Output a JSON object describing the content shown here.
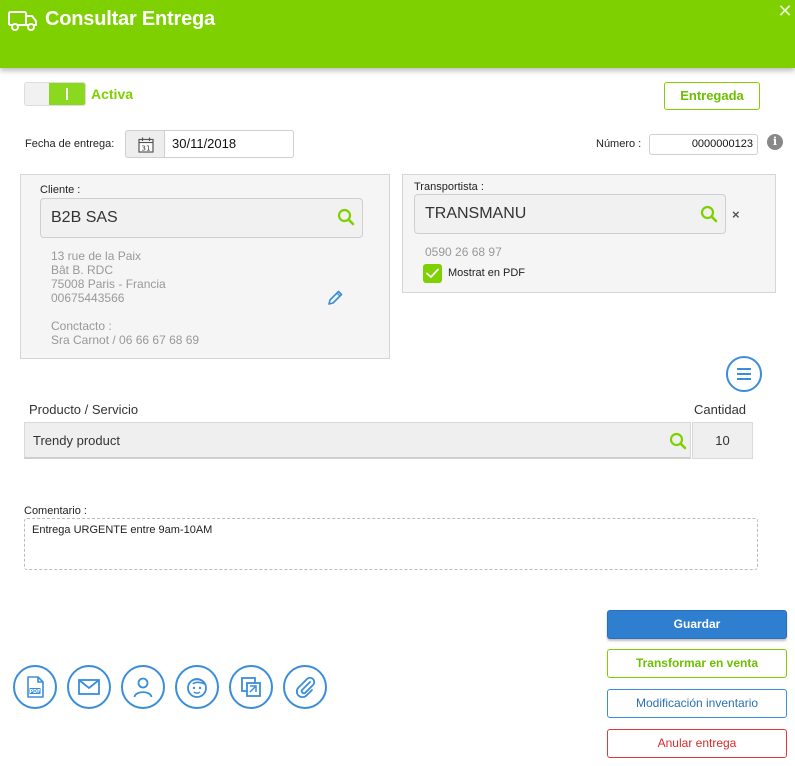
{
  "header": {
    "title": "Consultar Entrega",
    "icon": "truck-icon",
    "close_icon": "close-icon",
    "close_glyph": "✕",
    "background_color": "#7ed000"
  },
  "toggle": {
    "label": "Activa",
    "on": true
  },
  "status_button": {
    "label": "Entregada"
  },
  "delivery_date": {
    "label": "Fecha de entrega:",
    "value": "30/11/2018",
    "day_icon_text": "31"
  },
  "numero": {
    "label": "Número :",
    "value": "0000000123",
    "info_glyph": "i"
  },
  "cliente": {
    "label": "Cliente :",
    "value": "B2B SAS",
    "address_lines": [
      "13 rue de la Paix",
      "Bât B. RDC",
      "75008 Paris - Francia",
      "00675443566"
    ],
    "contact_label": "Conctacto :",
    "contact_value": "Sra Carnot / 06 66 67 68 69"
  },
  "transportista": {
    "label": "Transportista :",
    "value": "TRANSMANU",
    "remove_glyph": "×",
    "phone": "0590 26 68 97",
    "pdf_checkbox_label": "Mostrat en PDF",
    "pdf_checked": true
  },
  "product_table": {
    "col_product": "Producto / Servicio",
    "col_quantity": "Cantidad",
    "rows": [
      {
        "product": "Trendy product",
        "quantity": "10"
      }
    ]
  },
  "comment": {
    "label": "Comentario :",
    "value": "Entrega URGENTE entre 9am-10AM"
  },
  "buttons": {
    "save": "Guardar",
    "transform": "Transformar en venta",
    "inventory": "Modificación inventario",
    "cancel": "Anular entrega"
  },
  "action_icons": [
    "pdf-icon",
    "mail-icon",
    "user-icon",
    "face-icon",
    "copy-icon",
    "paperclip-icon"
  ],
  "pdf_icon_text": "PDF",
  "colors": {
    "accent_green": "#7ed000",
    "accent_blue": "#3a8ed8",
    "danger_red": "#e0393b"
  }
}
